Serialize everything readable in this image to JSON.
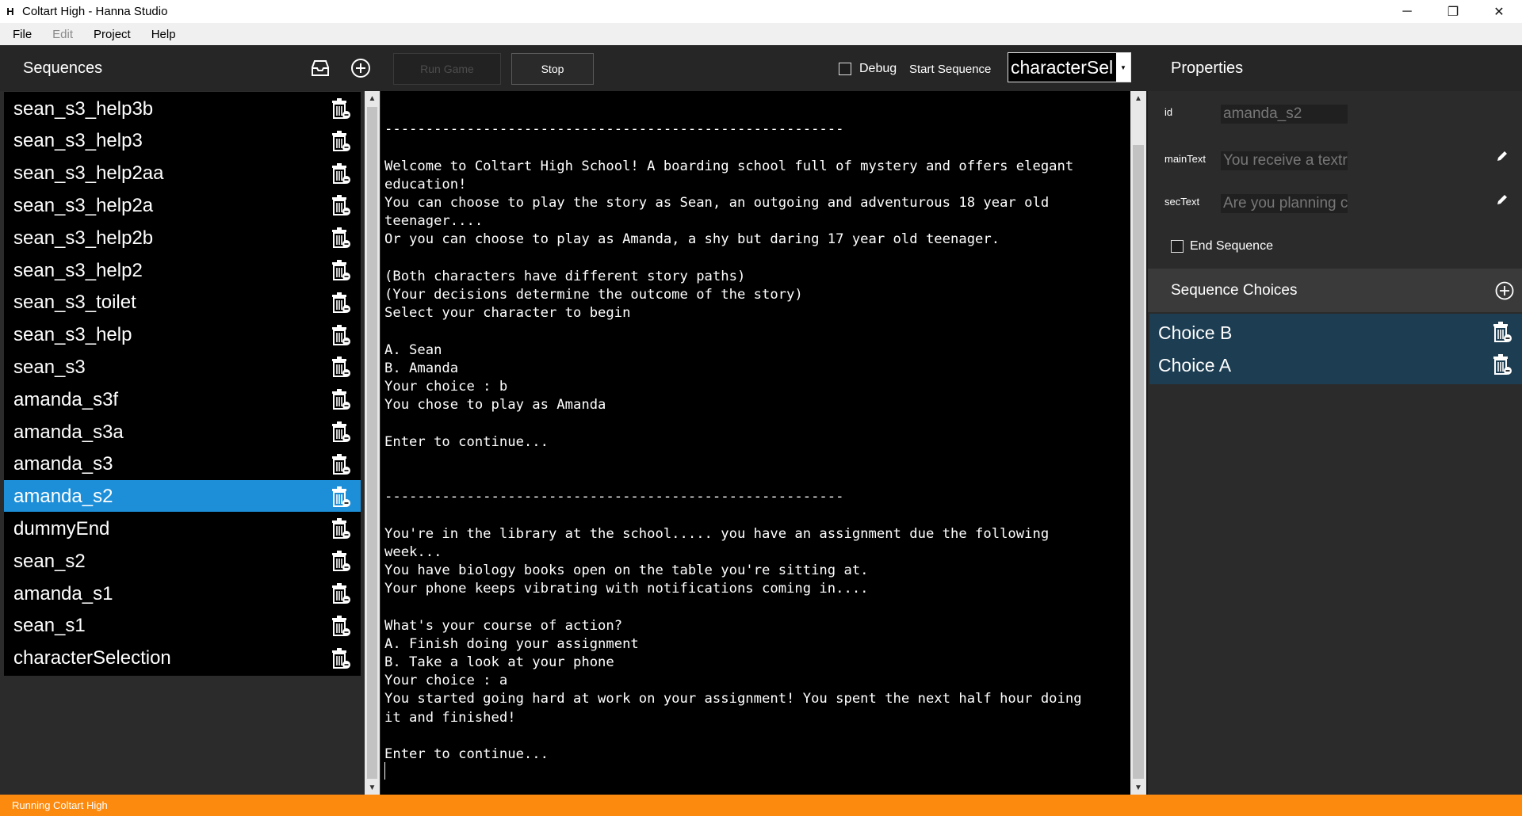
{
  "window": {
    "app_icon": "H",
    "title": "Coltart High - Hanna Studio",
    "minimize": "─",
    "maximize": "❐",
    "close": "✕"
  },
  "menu": [
    "File",
    "Edit",
    "Project",
    "Help"
  ],
  "sequences_panel": {
    "title": "Sequences",
    "items": [
      {
        "label": "sean_s3_help3b",
        "selected": false
      },
      {
        "label": "sean_s3_help3",
        "selected": false
      },
      {
        "label": "sean_s3_help2aa",
        "selected": false
      },
      {
        "label": "sean_s3_help2a",
        "selected": false
      },
      {
        "label": "sean_s3_help2b",
        "selected": false
      },
      {
        "label": "sean_s3_help2",
        "selected": false
      },
      {
        "label": "sean_s3_toilet",
        "selected": false
      },
      {
        "label": "sean_s3_help",
        "selected": false
      },
      {
        "label": "sean_s3",
        "selected": false
      },
      {
        "label": "amanda_s3f",
        "selected": false
      },
      {
        "label": "amanda_s3a",
        "selected": false
      },
      {
        "label": "amanda_s3",
        "selected": false
      },
      {
        "label": "amanda_s2",
        "selected": true
      },
      {
        "label": "dummyEnd",
        "selected": false
      },
      {
        "label": "sean_s2",
        "selected": false
      },
      {
        "label": "amanda_s1",
        "selected": false
      },
      {
        "label": "sean_s1",
        "selected": false
      },
      {
        "label": "characterSelection",
        "selected": false
      }
    ]
  },
  "toolbar": {
    "run_label": "Run Game",
    "stop_label": "Stop",
    "debug_label": "Debug",
    "debug_checked": false,
    "start_sequence_label": "Start Sequence",
    "start_sequence_value": "characterSelection"
  },
  "console": {
    "lines": [
      "",
      "--------------------------------------------------------",
      "",
      "Welcome to Coltart High School! A boarding school full of mystery and offers elegant",
      "education!",
      "You can choose to play the story as Sean, an outgoing and adventurous 18 year old",
      "teenager....",
      "Or you can choose to play as Amanda, a shy but daring 17 year old teenager.",
      "",
      "(Both characters have different story paths)",
      "(Your decisions determine the outcome of the story)",
      "Select your character to begin",
      "",
      "A. Sean",
      "B. Amanda",
      "Your choice : b",
      "You chose to play as Amanda",
      "",
      "Enter to continue...",
      "",
      "",
      "--------------------------------------------------------",
      "",
      "You're in the library at the school..... you have an assignment due the following",
      "week...",
      "You have biology books open on the table you're sitting at.",
      "Your phone keeps vibrating with notifications coming in....",
      "",
      "What's your course of action?",
      "A. Finish doing your assignment",
      "B. Take a look at your phone",
      "Your choice : a",
      "You started going hard at work on your assignment! You spent the next half hour doing",
      "it and finished!",
      "",
      "Enter to continue..."
    ]
  },
  "properties": {
    "title": "Properties",
    "id_label": "id",
    "id_value": "amanda_s2",
    "mainText_label": "mainText",
    "mainText_value": "You receive a textr",
    "secText_label": "secText",
    "secText_value": "Are you planning c",
    "end_sequence_label": "End Sequence",
    "end_sequence_checked": false
  },
  "choices": {
    "title": "Sequence Choices",
    "items": [
      "Choice B",
      "Choice A"
    ]
  },
  "status": {
    "text": "Running Coltart High",
    "color": "#fc8a0f"
  },
  "colors": {
    "selected": "#1d8fd9",
    "choice_bg": "#1c3d52"
  }
}
